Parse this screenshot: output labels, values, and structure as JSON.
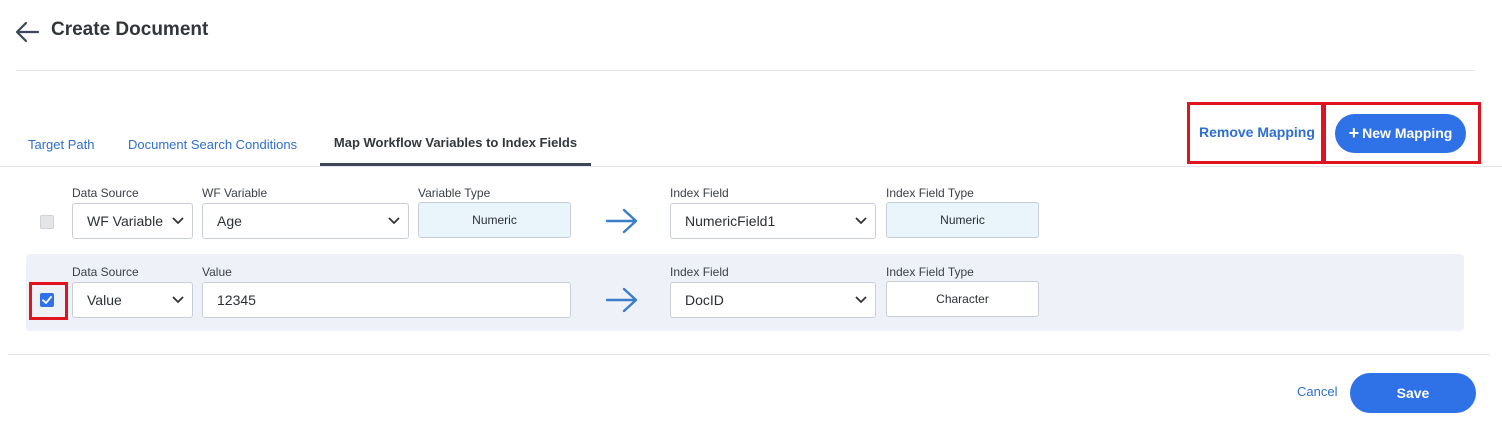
{
  "header": {
    "title": "Create Document",
    "back_icon": "arrow-left-icon"
  },
  "tabs": [
    {
      "label": "Target Path",
      "active": false
    },
    {
      "label": "Document Search Conditions",
      "active": false
    },
    {
      "label": "Map Workflow Variables to Index Fields",
      "active": true
    }
  ],
  "actions": {
    "remove_mapping": "Remove Mapping",
    "new_mapping": "New Mapping",
    "new_mapping_icon": "plus-icon"
  },
  "rows": [
    {
      "checked": false,
      "data_source_label": "Data Source",
      "data_source_value": "WF Variable",
      "wf_variable_label": "WF Variable",
      "wf_variable_value": "Age",
      "variable_type_label": "Variable Type",
      "variable_type_value": "Numeric",
      "index_field_label": "Index Field",
      "index_field_value": "NumericField1",
      "index_field_type_label": "Index Field Type",
      "index_field_type_value": "Numeric"
    },
    {
      "checked": true,
      "data_source_label": "Data Source",
      "data_source_value": "Value",
      "value_label": "Value",
      "value_value": "12345",
      "index_field_label": "Index Field",
      "index_field_value": "DocID",
      "index_field_type_label": "Index Field Type",
      "index_field_type_value": "Character"
    }
  ],
  "footer": {
    "cancel": "Cancel",
    "save": "Save"
  },
  "colors": {
    "accent": "#2f72e8",
    "link": "#2f6fd1",
    "highlight": "#e0141f",
    "numeric_fill": "#e9f4fb",
    "row_selected_bg": "#eef2f8"
  }
}
